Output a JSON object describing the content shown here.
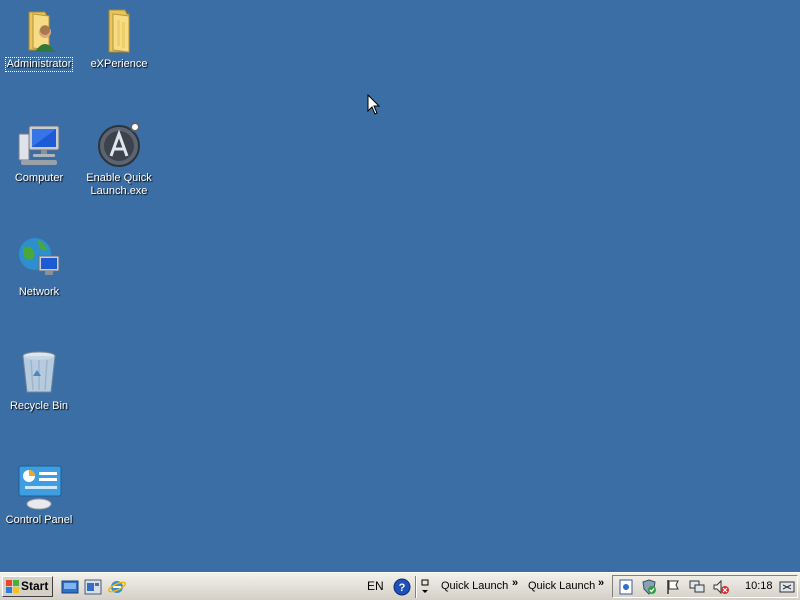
{
  "desktop": {
    "background_color": "#3a6ea5",
    "icons": [
      {
        "label": "Administrator",
        "icon": "user-folder-icon"
      },
      {
        "label": "eXPerience",
        "icon": "folder-icon"
      },
      {
        "label": "Computer",
        "icon": "computer-icon"
      },
      {
        "label": "Enable Quick Launch.exe",
        "icon": "app-a-logo-icon"
      },
      {
        "label": "Network",
        "icon": "network-globe-icon"
      },
      {
        "label": "Recycle Bin",
        "icon": "recycle-bin-icon"
      },
      {
        "label": "Control Panel",
        "icon": "control-panel-icon"
      }
    ]
  },
  "taskbar": {
    "start_label": "Start",
    "language": "EN",
    "toolbars": [
      "Quick Launch",
      "Quick Launch"
    ],
    "overflow_glyph": "»",
    "clock": "10:18"
  }
}
